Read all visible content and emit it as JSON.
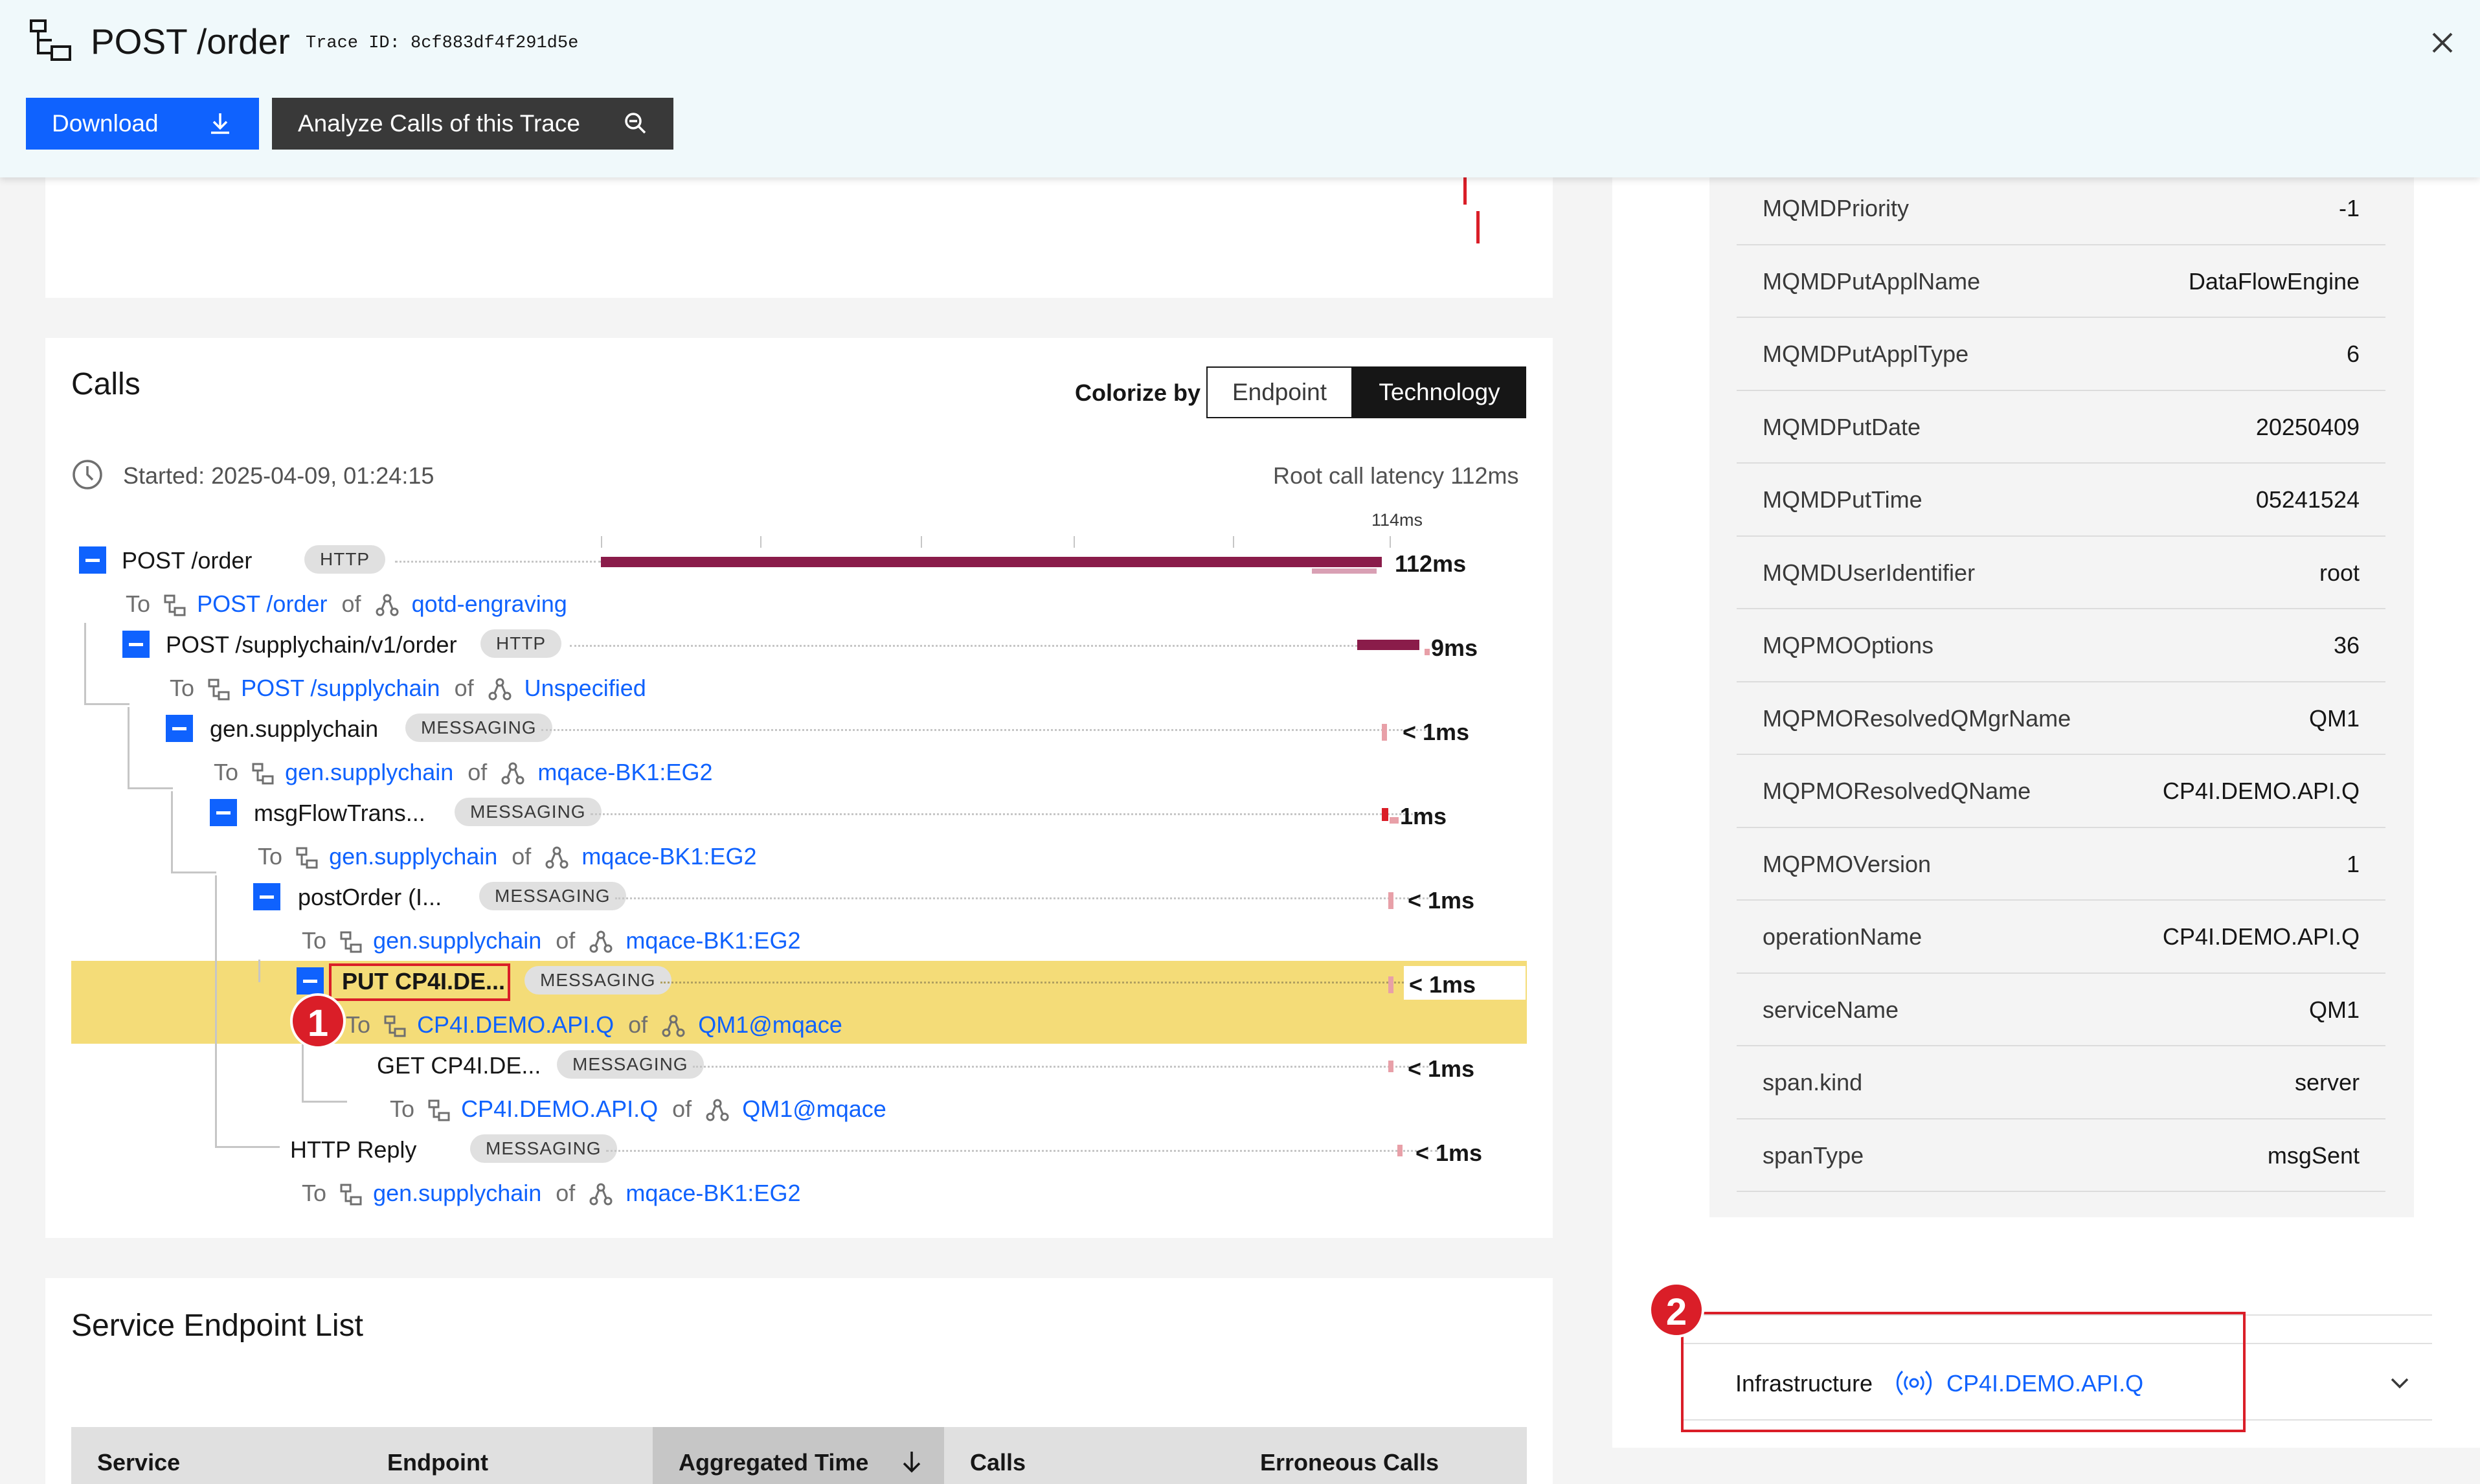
{
  "header": {
    "title": "POST /order",
    "trace_label": "Trace ID: 8cf883df4f291d5e",
    "download_label": "Download",
    "analyze_label": "Analyze Calls of this Trace"
  },
  "calls": {
    "title": "Calls",
    "colorize_label": "Colorize by",
    "toggle": [
      "Endpoint",
      "Technology"
    ],
    "selected_toggle": "Technology",
    "started": "Started: 2025-04-09, 01:24:15",
    "root_latency": "Root call latency 112ms",
    "scale_label": "114ms",
    "rows": [
      {
        "name": "POST /order",
        "tag": "HTTP",
        "latency": "112ms",
        "to_label": "To",
        "target": "POST /order",
        "of_label": "of",
        "service": "qotd-engraving"
      },
      {
        "name": "POST /supplychain/v1/order",
        "tag": "HTTP",
        "latency": "9ms",
        "to_label": "To",
        "target": "POST /supplychain",
        "of_label": "of",
        "service": "Unspecified"
      },
      {
        "name": "gen.supplychain",
        "tag": "MESSAGING",
        "latency": "< 1ms",
        "to_label": "To",
        "target": "gen.supplychain",
        "of_label": "of",
        "service": "mqace-BK1:EG2"
      },
      {
        "name": "msgFlowTrans...",
        "tag": "MESSAGING",
        "latency": "1ms",
        "to_label": "To",
        "target": "gen.supplychain",
        "of_label": "of",
        "service": "mqace-BK1:EG2"
      },
      {
        "name": "postOrder (I...",
        "tag": "MESSAGING",
        "latency": "< 1ms",
        "to_label": "To",
        "target": "gen.supplychain",
        "of_label": "of",
        "service": "mqace-BK1:EG2"
      },
      {
        "name": "PUT CP4I.DE...",
        "tag": "MESSAGING",
        "latency": "< 1ms",
        "to_label": "To",
        "target": "CP4I.DEMO.API.Q",
        "of_label": "of",
        "service": "QM1@mqace"
      },
      {
        "name": "GET CP4I.DE...",
        "tag": "MESSAGING",
        "latency": "< 1ms",
        "to_label": "To",
        "target": "CP4I.DEMO.API.Q",
        "of_label": "of",
        "service": "QM1@mqace"
      },
      {
        "name": "HTTP Reply",
        "tag": "MESSAGING",
        "latency": "< 1ms",
        "to_label": "To",
        "target": "gen.supplychain",
        "of_label": "of",
        "service": "mqace-BK1:EG2"
      }
    ]
  },
  "endpoints": {
    "title": "Service Endpoint List",
    "columns": [
      "Service",
      "Endpoint",
      "Aggregated Time",
      "Calls",
      "Erroneous Calls"
    ]
  },
  "tags_table": [
    {
      "key": "MQMDPriority",
      "value": "-1"
    },
    {
      "key": "MQMDPutApplName",
      "value": "DataFlowEngine"
    },
    {
      "key": "MQMDPutApplType",
      "value": "6"
    },
    {
      "key": "MQMDPutDate",
      "value": "20250409"
    },
    {
      "key": "MQMDPutTime",
      "value": "05241524"
    },
    {
      "key": "MQMDUserIdentifier",
      "value": "root"
    },
    {
      "key": "MQPMOOptions",
      "value": "36"
    },
    {
      "key": "MQPMOResolvedQMgrName",
      "value": "QM1"
    },
    {
      "key": "MQPMOResolvedQName",
      "value": "CP4I.DEMO.API.Q"
    },
    {
      "key": "MQPMOVersion",
      "value": "1"
    },
    {
      "key": "operationName",
      "value": "CP4I.DEMO.API.Q"
    },
    {
      "key": "serviceName",
      "value": "QM1"
    },
    {
      "key": "span.kind",
      "value": "server"
    },
    {
      "key": "spanType",
      "value": "msgSent"
    }
  ],
  "infrastructure": {
    "label": "Infrastructure",
    "value": "CP4I.DEMO.API.Q"
  },
  "annotations": {
    "badge1": "1",
    "badge2": "2"
  },
  "colors": {
    "accent": "#0f62fe",
    "http_bar": "#8a1c4a",
    "messaging_bar": "#e8a0a8",
    "highlight": "#f4dc78",
    "annotation": "#da1e28"
  }
}
